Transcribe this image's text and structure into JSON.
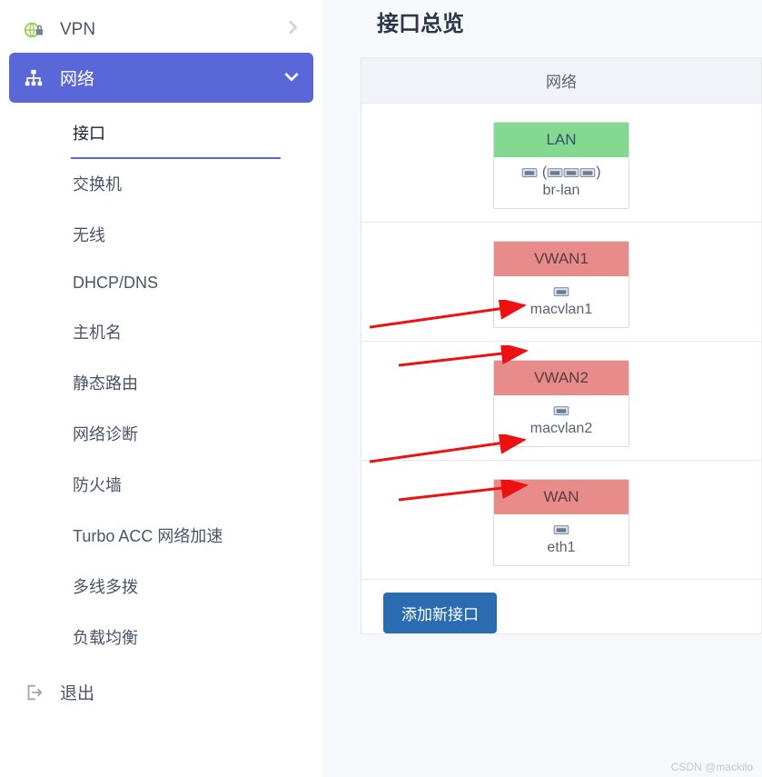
{
  "sidebar": {
    "vpn": {
      "label": "VPN"
    },
    "network": {
      "label": "网络"
    },
    "submenu": [
      {
        "label": "接口",
        "active": true
      },
      {
        "label": "交换机"
      },
      {
        "label": "无线"
      },
      {
        "label": "DHCP/DNS"
      },
      {
        "label": "主机名"
      },
      {
        "label": "静态路由"
      },
      {
        "label": "网络诊断"
      },
      {
        "label": "防火墙"
      },
      {
        "label": "Turbo ACC 网络加速"
      },
      {
        "label": "多线多拨"
      },
      {
        "label": "负载均衡"
      }
    ],
    "logout": {
      "label": "退出"
    }
  },
  "main": {
    "title": "接口总览",
    "column_header": "网络",
    "interfaces": [
      {
        "name": "LAN",
        "device": "br-lan",
        "color": "green",
        "multi": true
      },
      {
        "name": "VWAN1",
        "device": "macvlan1",
        "color": "red",
        "multi": false
      },
      {
        "name": "VWAN2",
        "device": "macvlan2",
        "color": "red",
        "multi": false
      },
      {
        "name": "WAN",
        "device": "eth1",
        "color": "red",
        "multi": false
      }
    ],
    "add_button": "添加新接口"
  },
  "watermark": "CSDN @mackilo"
}
